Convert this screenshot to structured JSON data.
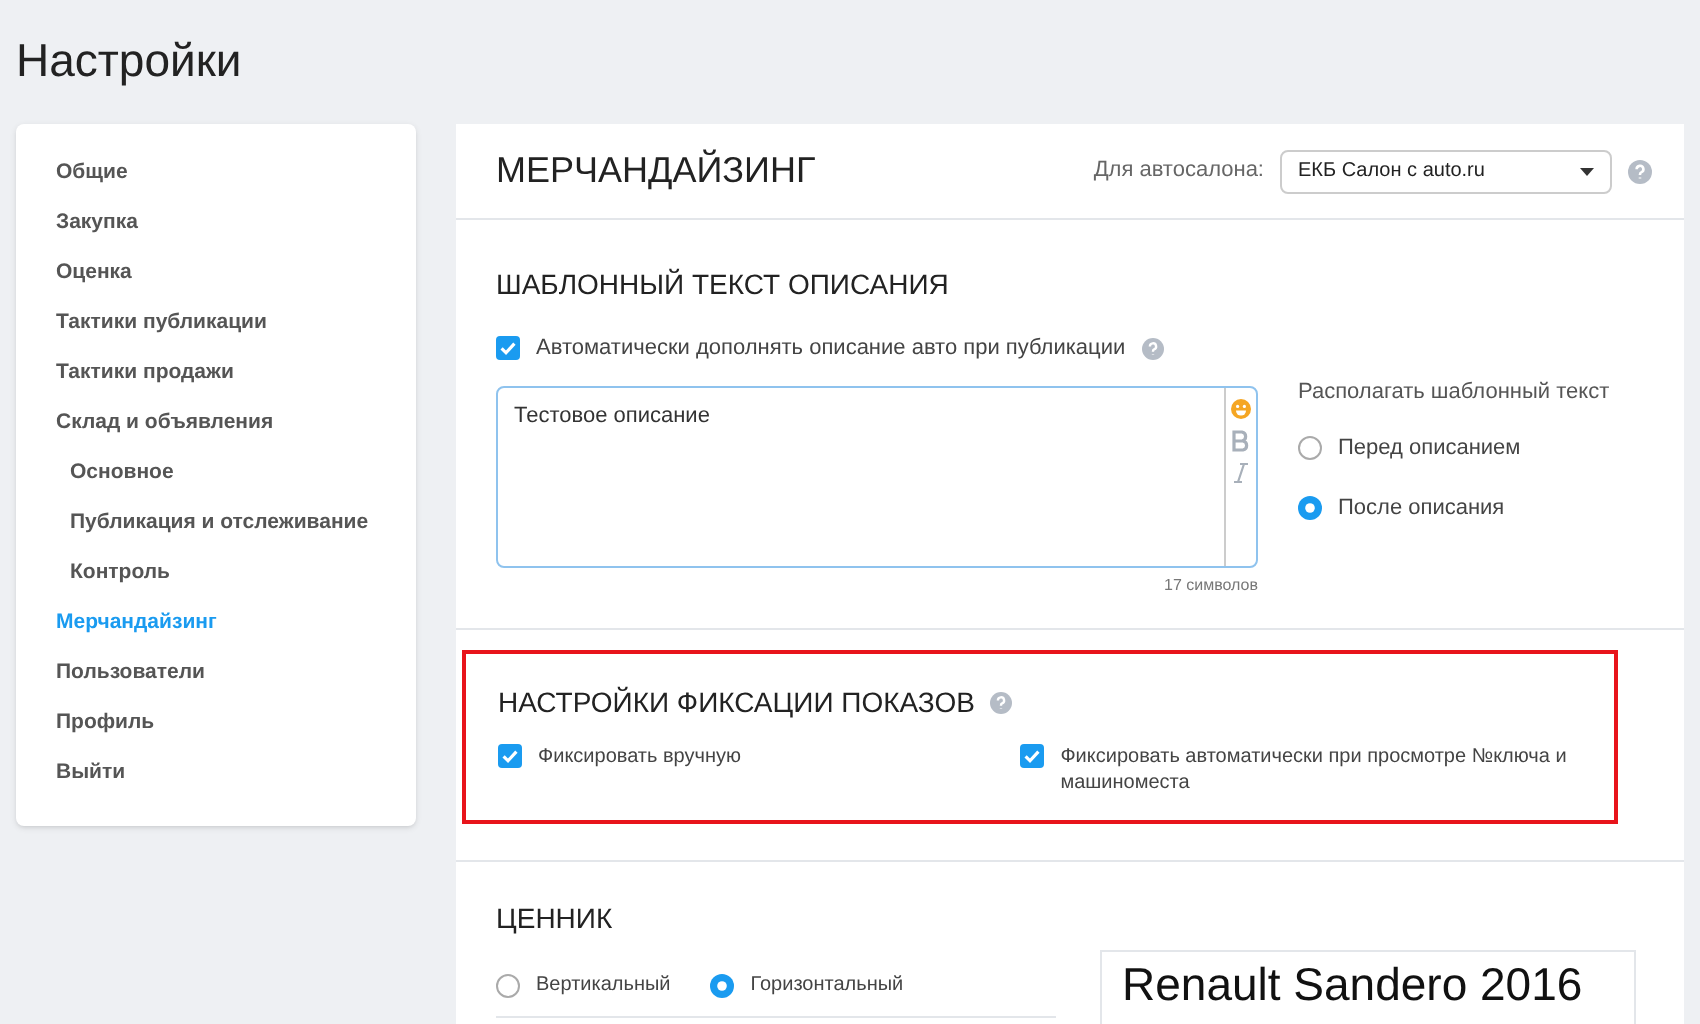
{
  "page_title": "Настройки",
  "sidebar": {
    "items": [
      {
        "label": "Общие",
        "selected": false
      },
      {
        "label": "Закупка",
        "selected": false
      },
      {
        "label": "Оценка",
        "selected": false
      },
      {
        "label": "Тактики публикации",
        "selected": false
      },
      {
        "label": "Тактики продажи",
        "selected": false
      },
      {
        "label": "Склад и объявления",
        "selected": false,
        "children": [
          {
            "label": "Основное",
            "selected": false
          },
          {
            "label": "Публикация и отслеживание",
            "selected": false
          },
          {
            "label": "Контроль",
            "selected": false
          }
        ]
      },
      {
        "label": "Мерчандайзинг",
        "selected": true
      },
      {
        "label": "Пользователи",
        "selected": false
      },
      {
        "label": "Профиль",
        "selected": false
      },
      {
        "label": "Выйти",
        "selected": false
      }
    ]
  },
  "header": {
    "title": "МЕРЧАНДАЙЗИНГ",
    "dealer_label": "Для автосалона:",
    "dealer_value": "ЕКБ Салон с auto.ru"
  },
  "template_section": {
    "title": "ШАБЛОННЫЙ ТЕКСТ ОПИСАНИЯ",
    "auto_checkbox": {
      "label": "Автоматически дополнять описание авто при публикации",
      "checked": true
    },
    "textarea_value": "Тестовое описание",
    "char_count": "17 символов",
    "position_label": "Располагать шаблонный текст",
    "position_options": [
      {
        "label": "Перед описанием",
        "selected": false
      },
      {
        "label": "После описания",
        "selected": true
      }
    ]
  },
  "fixation_section": {
    "title": "НАСТРОЙКИ ФИКСАЦИИ ПОКАЗОВ",
    "highlighted": true,
    "options": [
      {
        "label": "Фиксировать вручную",
        "checked": true
      },
      {
        "label": "Фиксировать автоматически при просмотре №ключа и машиноместа",
        "checked": true
      }
    ]
  },
  "price_tag_section": {
    "title": "ЦЕННИК",
    "orientation_options": [
      {
        "label": "Вертикальный",
        "selected": false
      },
      {
        "label": "Горизонтальный",
        "selected": true
      }
    ],
    "preview_title": "Renault Sandero 2016"
  }
}
